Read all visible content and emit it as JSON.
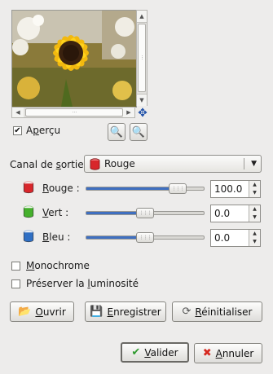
{
  "preview": {
    "checkbox_checked": true,
    "label_pre": "A",
    "label_mnemonic": "p",
    "label_post": "erçu"
  },
  "channel": {
    "label_pre": "Canal de ",
    "label_mnemonic": "s",
    "label_post": "ortie :",
    "selected": "Rouge",
    "icon_color": "#d8262b"
  },
  "sliders": [
    {
      "label_mnemonic": "R",
      "label_post": "ouge :",
      "value": "100.0",
      "level": 1.0,
      "color": "#d8262b"
    },
    {
      "label_mnemonic": "V",
      "label_post": "ert :",
      "value": "0.0",
      "level": 0.0,
      "color": "#45b02c"
    },
    {
      "label_mnemonic": "B",
      "label_post": "leu :",
      "value": "0.0",
      "level": 0.0,
      "color": "#2f6fc4"
    }
  ],
  "options": {
    "monochrome_pre": "",
    "monochrome_mnemonic": "M",
    "monochrome_post": "onochrome",
    "preserve_pre": "Préserver la ",
    "preserve_mnemonic": "l",
    "preserve_post": "uminosité"
  },
  "buttons": {
    "open_mnemonic": "O",
    "open_post": "uvrir",
    "save_mnemonic": "E",
    "save_post": "nregistrer",
    "reset_mnemonic": "R",
    "reset_post": "éinitialiser",
    "ok_mnemonic": "V",
    "ok_post": "alider",
    "cancel_mnemonic": "A",
    "cancel_post": "nnuler"
  },
  "colors": {
    "accent": "#3f6fc0",
    "background": "#edeceb"
  }
}
